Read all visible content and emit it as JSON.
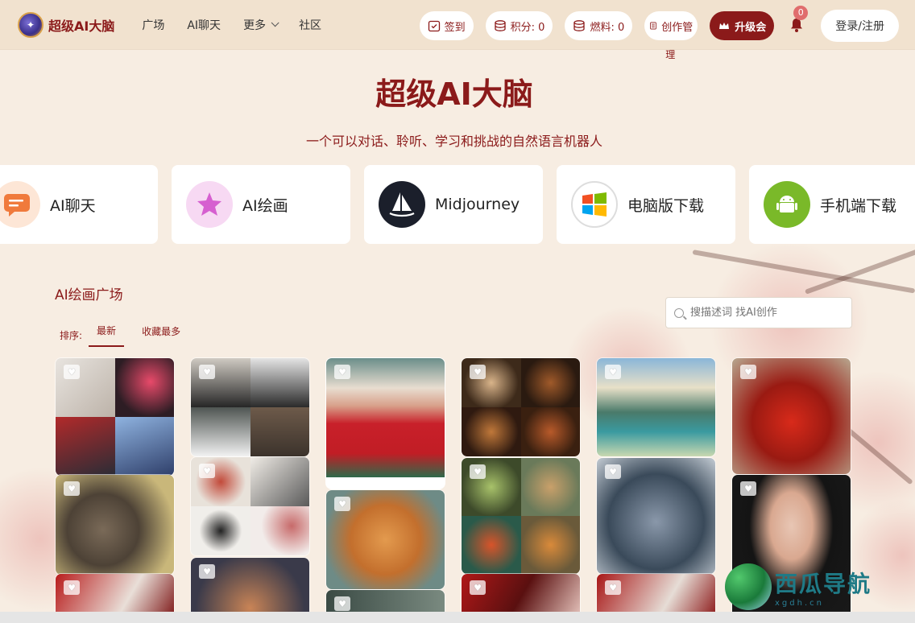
{
  "header": {
    "logo_text": "超级AI大脑",
    "nav": [
      {
        "label": "广场"
      },
      {
        "label": "AI聊天"
      },
      {
        "label": "更多"
      },
      {
        "label": "社区"
      }
    ],
    "checkin_label": "签到",
    "points_label": "积分: 0",
    "fuel_label": "燃料: 0",
    "create_label_1": "创作管",
    "create_label_2": "理",
    "upgrade_label": "升级会",
    "notif_count": "0",
    "login_label": "登录/注册"
  },
  "hero": {
    "title": "超级AI大脑",
    "subtitle": "一个可以对话、聆听、学习和挑战的自然语言机器人"
  },
  "features": [
    {
      "label": "AI聊天",
      "icon": "chat-icon"
    },
    {
      "label": "AI绘画",
      "icon": "paint-star-icon"
    },
    {
      "label": "Midjourney",
      "icon": "midjourney-sailboat-icon"
    },
    {
      "label": "电脑版下载",
      "icon": "windows-icon"
    },
    {
      "label": "手机端下载",
      "icon": "android-icon"
    }
  ],
  "gallery_section": {
    "title": "AI绘画广场",
    "search_placeholder": "搜描述词 找AI创作",
    "sort_label": "排序:",
    "sort_options": [
      "最新",
      "收藏最多"
    ]
  },
  "watermark": {
    "text": "西瓜导航",
    "url": "xgdh.cn"
  },
  "colors": {
    "brand": "#8b1a1a",
    "header_bg": "#f1e2cf",
    "page_bg": "#f7ede2"
  }
}
